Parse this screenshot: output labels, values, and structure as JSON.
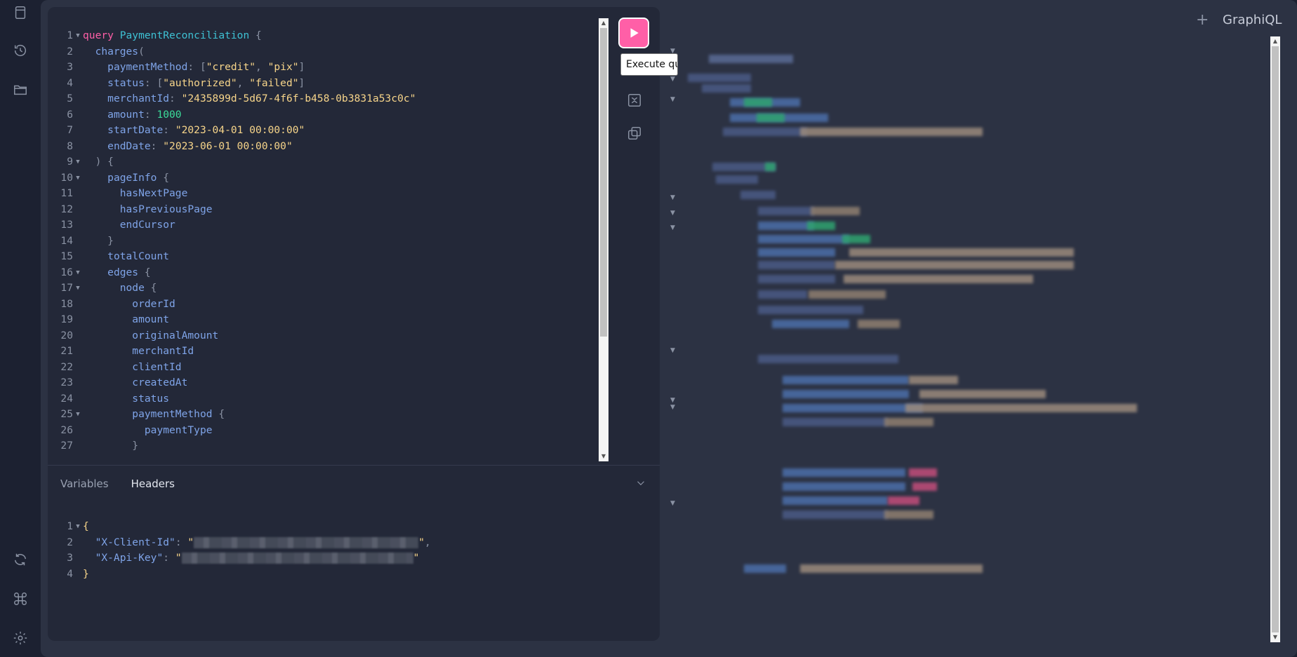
{
  "sidebar": {
    "top_icons": [
      "document-icon",
      "history-icon",
      "explorer-folder-icon"
    ],
    "bottom_icons": [
      "refetch-schema-icon",
      "keyboard-shortcuts-icon",
      "settings-icon"
    ]
  },
  "editor": {
    "lines": [
      [
        [
          "kw",
          "query"
        ],
        [
          "txt",
          " "
        ],
        [
          "tn",
          "PaymentReconciliation"
        ],
        [
          "txt",
          " "
        ],
        [
          "pu",
          "{"
        ]
      ],
      [
        [
          "txt",
          "  "
        ],
        [
          "fd",
          "charges"
        ],
        [
          "pu",
          "("
        ]
      ],
      [
        [
          "txt",
          "    "
        ],
        [
          "fd",
          "paymentMethod"
        ],
        [
          "pu",
          ": ["
        ],
        [
          "st",
          "\"credit\""
        ],
        [
          "pu",
          ", "
        ],
        [
          "st",
          "\"pix\""
        ],
        [
          "pu",
          "]"
        ]
      ],
      [
        [
          "txt",
          "    "
        ],
        [
          "fd",
          "status"
        ],
        [
          "pu",
          ": ["
        ],
        [
          "st",
          "\"authorized\""
        ],
        [
          "pu",
          ", "
        ],
        [
          "st",
          "\"failed\""
        ],
        [
          "pu",
          "]"
        ]
      ],
      [
        [
          "txt",
          "    "
        ],
        [
          "fd",
          "merchantId"
        ],
        [
          "pu",
          ": "
        ],
        [
          "st",
          "\"2435899d-5d67-4f6f-b458-0b3831a53c0c\""
        ]
      ],
      [
        [
          "txt",
          "    "
        ],
        [
          "fd",
          "amount"
        ],
        [
          "pu",
          ": "
        ],
        [
          "nu",
          "1000"
        ]
      ],
      [
        [
          "txt",
          "    "
        ],
        [
          "fd",
          "startDate"
        ],
        [
          "pu",
          ": "
        ],
        [
          "st",
          "\"2023-04-01 00:00:00\""
        ]
      ],
      [
        [
          "txt",
          "    "
        ],
        [
          "fd",
          "endDate"
        ],
        [
          "pu",
          ": "
        ],
        [
          "st",
          "\"2023-06-01 00:00:00\""
        ]
      ],
      [
        [
          "txt",
          "  "
        ],
        [
          "pu",
          ") {"
        ]
      ],
      [
        [
          "txt",
          "    "
        ],
        [
          "fd",
          "pageInfo"
        ],
        [
          "txt",
          " "
        ],
        [
          "pu",
          "{"
        ]
      ],
      [
        [
          "txt",
          "      "
        ],
        [
          "fd",
          "hasNextPage"
        ]
      ],
      [
        [
          "txt",
          "      "
        ],
        [
          "fd",
          "hasPreviousPage"
        ]
      ],
      [
        [
          "txt",
          "      "
        ],
        [
          "fd",
          "endCursor"
        ]
      ],
      [
        [
          "txt",
          "    "
        ],
        [
          "pu",
          "}"
        ]
      ],
      [
        [
          "txt",
          "    "
        ],
        [
          "fd",
          "totalCount"
        ]
      ],
      [
        [
          "txt",
          "    "
        ],
        [
          "fd",
          "edges"
        ],
        [
          "txt",
          " "
        ],
        [
          "pu",
          "{"
        ]
      ],
      [
        [
          "txt",
          "      "
        ],
        [
          "fd",
          "node"
        ],
        [
          "txt",
          " "
        ],
        [
          "pu",
          "{"
        ]
      ],
      [
        [
          "txt",
          "        "
        ],
        [
          "fd",
          "orderId"
        ]
      ],
      [
        [
          "txt",
          "        "
        ],
        [
          "fd",
          "amount"
        ]
      ],
      [
        [
          "txt",
          "        "
        ],
        [
          "fd",
          "originalAmount"
        ]
      ],
      [
        [
          "txt",
          "        "
        ],
        [
          "fd",
          "merchantId"
        ]
      ],
      [
        [
          "txt",
          "        "
        ],
        [
          "fd",
          "clientId"
        ]
      ],
      [
        [
          "txt",
          "        "
        ],
        [
          "fd",
          "createdAt"
        ]
      ],
      [
        [
          "txt",
          "        "
        ],
        [
          "fd",
          "status"
        ]
      ],
      [
        [
          "txt",
          "        "
        ],
        [
          "fd",
          "paymentMethod"
        ],
        [
          "txt",
          " "
        ],
        [
          "pu",
          "{"
        ]
      ],
      [
        [
          "txt",
          "          "
        ],
        [
          "fd",
          "paymentType"
        ]
      ],
      [
        [
          "txt",
          "        "
        ],
        [
          "pu",
          "}"
        ]
      ]
    ],
    "foldable_lines": [
      1,
      9,
      10,
      16,
      17,
      25
    ]
  },
  "toolbar": {
    "run_tooltip": "Execute qu",
    "icons": [
      "run-query-icon",
      "prettify-icon",
      "copy-query-icon"
    ]
  },
  "bottom_panel": {
    "tabs": [
      "Variables",
      "Headers"
    ],
    "active_tab": "Headers",
    "header_lines": [
      [
        [
          "brace",
          "{"
        ]
      ],
      [
        [
          "txt",
          "  "
        ],
        [
          "key",
          "\"X-Client-Id\""
        ],
        [
          "pu",
          ": "
        ],
        [
          "st",
          "\""
        ],
        [
          "redact",
          "320"
        ],
        [
          "st",
          "\""
        ],
        [
          "pu",
          ","
        ]
      ],
      [
        [
          "txt",
          "  "
        ],
        [
          "key",
          "\"X-Api-Key\""
        ],
        [
          "pu",
          ": "
        ],
        [
          "st",
          "\""
        ],
        [
          "redact",
          "330"
        ],
        [
          "st",
          "\""
        ]
      ],
      [
        [
          "brace",
          "}"
        ]
      ]
    ]
  },
  "result_panel": {
    "brand": "GraphiQL",
    "add_tab_label": "+"
  },
  "colors": {
    "accent": "#ff5fa7",
    "background": "#1c2131",
    "panel": "#232838"
  }
}
